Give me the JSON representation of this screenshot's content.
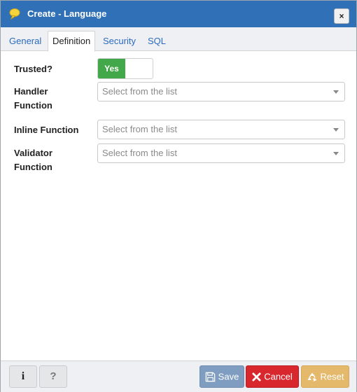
{
  "dialog": {
    "title": "Create - Language",
    "close_label": "×"
  },
  "tabs": [
    {
      "label": "General",
      "active": false
    },
    {
      "label": "Definition",
      "active": true
    },
    {
      "label": "Security",
      "active": false
    },
    {
      "label": "SQL",
      "active": false
    }
  ],
  "form": {
    "trusted": {
      "label": "Trusted?",
      "value_label": "Yes",
      "on": true
    },
    "handler_function": {
      "label_line1": "Handler",
      "label_line2": "Function",
      "placeholder": "Select from the list"
    },
    "inline_function": {
      "label": "Inline Function",
      "placeholder": "Select from the list"
    },
    "validator_function": {
      "label_line1": "Validator",
      "label_line2": "Function",
      "placeholder": "Select from the list"
    }
  },
  "footer": {
    "info_label": "i",
    "help_label": "?",
    "save_label": "Save",
    "cancel_label": "Cancel",
    "reset_label": "Reset"
  },
  "colors": {
    "titlebar": "#2f70b6",
    "toggle_on": "#43a84a",
    "save": "#7f9dc0",
    "cancel": "#d9272e",
    "reset": "#e5b96b"
  },
  "icons": {
    "title": "speech-bubble-icon",
    "save": "floppy-disk-icon",
    "cancel": "x-icon",
    "reset": "recycle-icon"
  }
}
